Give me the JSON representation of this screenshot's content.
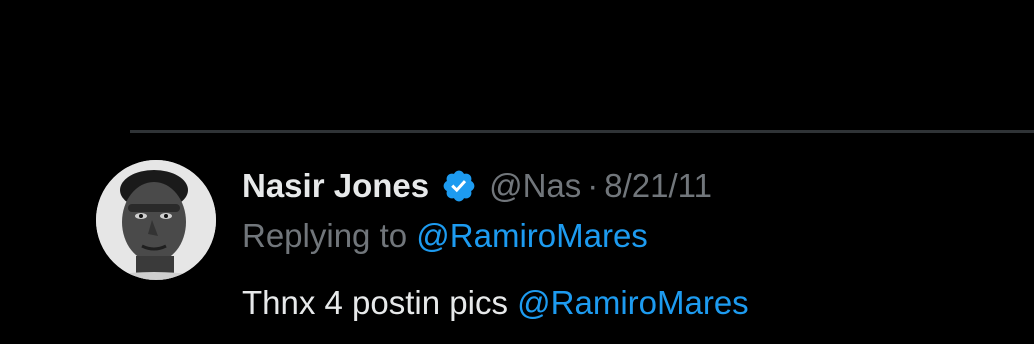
{
  "tweet": {
    "display_name": "Nasir Jones",
    "verified": true,
    "handle": "@Nas",
    "separator": "·",
    "date": "8/21/11",
    "reply_label": "Replying to",
    "reply_to": "@RamiroMares",
    "text_plain": "Thnx 4 postin pics",
    "text_mention": "@RamiroMares"
  },
  "colors": {
    "background": "#000000",
    "primary_text": "#e7e9ea",
    "secondary_text": "#71767b",
    "link": "#1d9bf0",
    "divider": "#2f3336"
  },
  "icons": {
    "verified": "verified-badge-icon",
    "avatar": "profile-photo"
  }
}
